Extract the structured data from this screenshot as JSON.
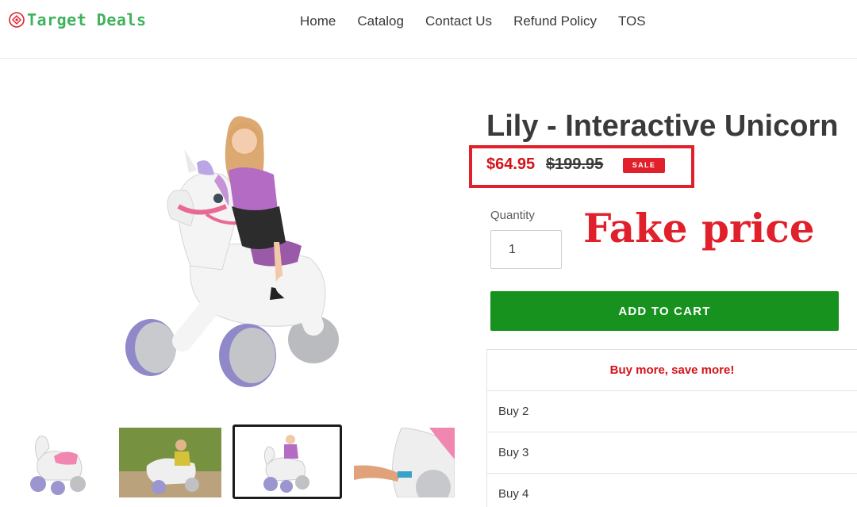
{
  "header": {
    "logo_text": "Target Deals",
    "logo_color": "#3fb25a",
    "nav": [
      "Home",
      "Catalog",
      "Contact Us",
      "Refund Policy",
      "TOS"
    ]
  },
  "product": {
    "title": "Lily - Interactive Unicorn",
    "sale_price": "$64.95",
    "regular_price": "$199.95",
    "badge": "SALE",
    "quantity_label": "Quantity",
    "quantity_value": "1",
    "add_to_cart": "ADD TO CART",
    "thumbnail_count": 4,
    "selected_thumbnail": 3
  },
  "annotation": {
    "text": "Fake price",
    "color": "#e0202b"
  },
  "bundle": {
    "heading": "Buy more, save more!",
    "rows": [
      "Buy 2",
      "Buy 3",
      "Buy 4"
    ]
  },
  "colors": {
    "sale_red": "#d4121a",
    "cart_green": "#17921f"
  }
}
